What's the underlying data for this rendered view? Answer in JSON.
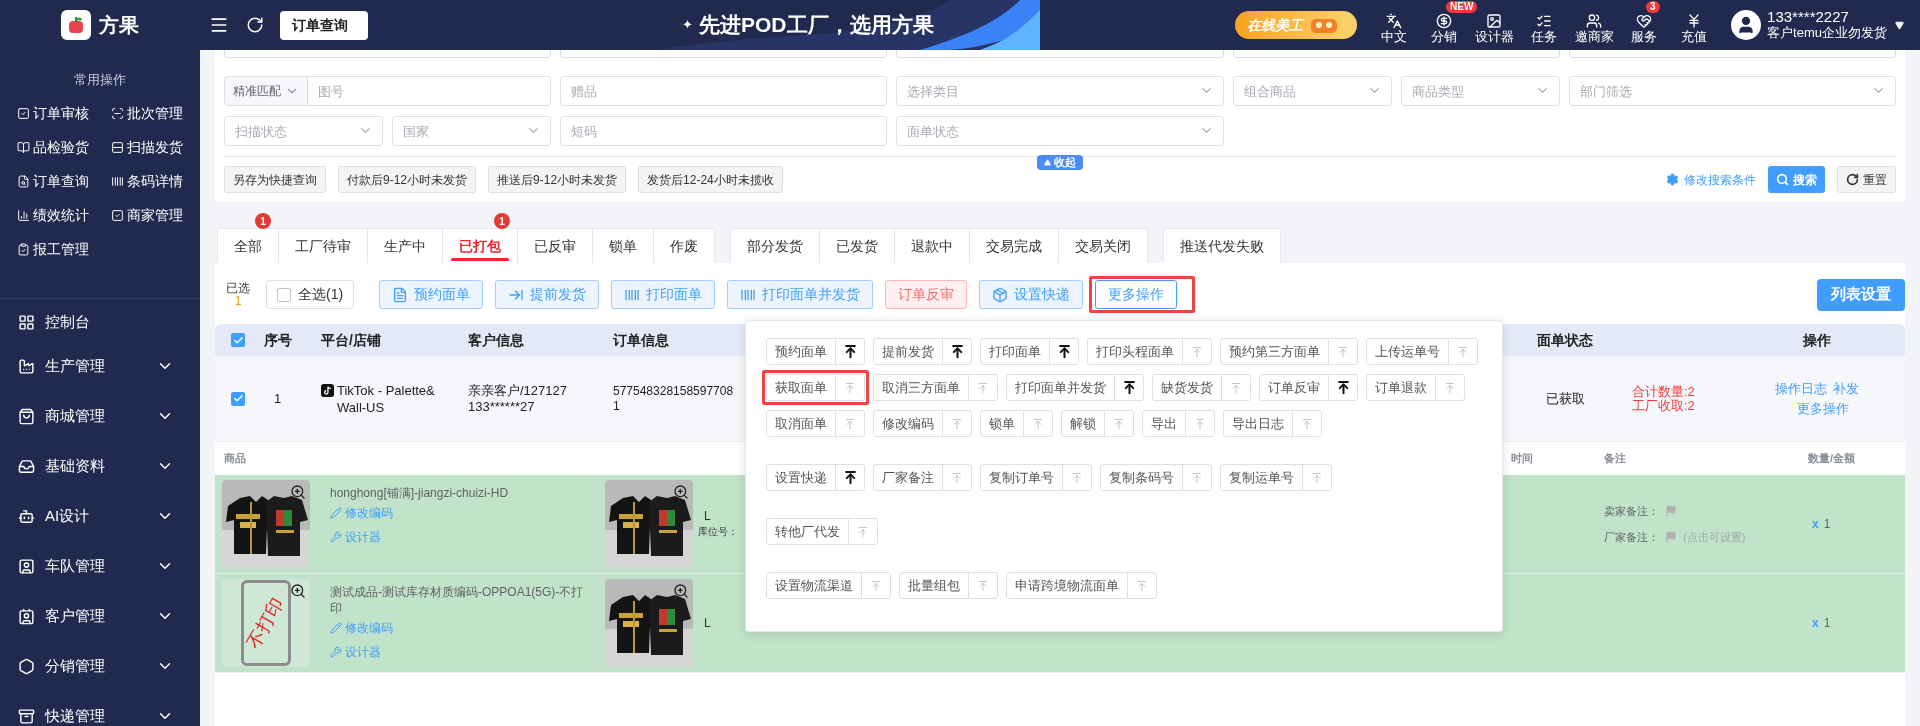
{
  "sidebar": {
    "logo": "方果",
    "quick_title": "常用操作",
    "quick_items": [
      "订单审核",
      "批次管理",
      "品检验货",
      "扫描发货",
      "订单查询",
      "条码详情",
      "绩效统计",
      "商家管理",
      "报工管理"
    ],
    "menu": [
      {
        "label": "控制台",
        "kind": "link"
      },
      {
        "label": "生产管理",
        "kind": "group"
      },
      {
        "label": "商城管理",
        "kind": "group"
      },
      {
        "label": "基础资料",
        "kind": "group"
      },
      {
        "label": "AI设计",
        "kind": "group"
      },
      {
        "label": "车队管理",
        "kind": "group"
      },
      {
        "label": "客户管理",
        "kind": "group"
      },
      {
        "label": "分销管理",
        "kind": "group"
      },
      {
        "label": "快递管理",
        "kind": "group"
      }
    ]
  },
  "topbar": {
    "page_tab": "订单查询",
    "slogan_mark": "✦",
    "slogan": "先进POD工厂，选用方果",
    "promo": "在线美工",
    "nav": [
      {
        "label": "中文"
      },
      {
        "label": "分销",
        "badge": "NEW"
      },
      {
        "label": "设计器"
      },
      {
        "label": "任务"
      },
      {
        "label": "邀商家"
      },
      {
        "label": "服务",
        "badge": "3"
      },
      {
        "label": "充值"
      }
    ],
    "user": {
      "phone": "133****2227",
      "name": "客户temu企业勿发货"
    }
  },
  "filters": {
    "rows": [
      [
        {
          "fields": [
            {
              "kind": "addon",
              "value": "精准匹配"
            },
            {
              "kind": "input",
              "placeholder": "图号"
            }
          ]
        },
        {
          "fields": [
            {
              "kind": "input",
              "placeholder": "赠品"
            }
          ]
        },
        {
          "fields": [
            {
              "kind": "select",
              "placeholder": "选择类目"
            }
          ]
        },
        {
          "fields": [
            {
              "kind": "select",
              "placeholder": "组合商品"
            },
            {
              "kind": "select",
              "placeholder": "商品类型"
            }
          ]
        },
        {
          "fields": [
            {
              "kind": "select",
              "placeholder": "部门筛选"
            }
          ]
        }
      ],
      [
        {
          "fields": [
            {
              "kind": "select",
              "placeholder": "扫描状态"
            },
            {
              "kind": "select",
              "placeholder": "国家"
            }
          ]
        },
        {
          "fields": [
            {
              "kind": "input",
              "placeholder": "短码"
            }
          ]
        },
        {
          "fields": [
            {
              "kind": "select",
              "placeholder": "面单状态"
            }
          ]
        }
      ]
    ],
    "collapse": "收起",
    "shortcuts": [
      "另存为快捷查询",
      "付款后9-12小时未发货",
      "推送后9-12小时未发货",
      "发货后12-24小时未揽收"
    ],
    "edit_conditions": "修改搜索条件",
    "search": "搜索",
    "reset": "重置"
  },
  "tabs": {
    "groups": [
      [
        {
          "label": "全部",
          "selected": false,
          "badge": "1"
        },
        {
          "label": "工厂待审",
          "selected": false
        },
        {
          "label": "生产中",
          "selected": false
        },
        {
          "label": "已打包",
          "selected": true,
          "badge": "1"
        },
        {
          "label": "已反审",
          "selected": false
        },
        {
          "label": "锁单",
          "selected": false
        },
        {
          "label": "作废",
          "selected": false
        }
      ],
      [
        {
          "label": "部分发货",
          "selected": false
        },
        {
          "label": "已发货",
          "selected": false
        },
        {
          "label": "退款中",
          "selected": false
        },
        {
          "label": "交易完成",
          "selected": false
        },
        {
          "label": "交易关闭",
          "selected": false
        }
      ],
      [
        {
          "label": "推送代发失败",
          "selected": false
        }
      ]
    ]
  },
  "toolbar": {
    "selected_label": "已选",
    "selected_count": "1",
    "select_all": {
      "label": "全选(1)",
      "checked": false
    },
    "actions": [
      {
        "label": "预约面单",
        "kind": "light",
        "highlighted": false
      },
      {
        "label": "提前发货",
        "kind": "light",
        "highlighted": false
      },
      {
        "label": "打印面单",
        "kind": "light",
        "highlighted": false
      },
      {
        "label": "打印面单并发货",
        "kind": "light",
        "highlighted": false
      },
      {
        "label": "订单反审",
        "kind": "danger",
        "highlighted": false
      },
      {
        "label": "设置快递",
        "kind": "light",
        "highlighted": false
      },
      {
        "label": "更多操作",
        "kind": "outline",
        "highlighted": true
      }
    ],
    "list_settings": "列表设置"
  },
  "table": {
    "all_checked": true,
    "columns": [
      "序号",
      "平台/店铺",
      "客户信息",
      "订单信息",
      "面单状态",
      "操作"
    ],
    "order": {
      "checked": true,
      "index": "1",
      "store": "TikTok - Palette&Wall-US",
      "customer": "亲亲客户/127127",
      "phone": "133******27",
      "order_no": "5775483281585977081",
      "label_status": "已获取",
      "totals": [
        "合计数量:2",
        "工厂收取:2"
      ],
      "actions": [
        "操作日志",
        "补发",
        "更多操作"
      ]
    },
    "product_columns": [
      "商品",
      "时间",
      "备注",
      "数量/金额"
    ],
    "products": [
      {
        "kind": "picture",
        "name": "honghong[铺满]-jiangzi-chuizi-HD",
        "edit": "修改编码",
        "designer": "设计器",
        "size": "L",
        "location": "库位号：",
        "seller_note": "卖家备注：",
        "factory_note": "厂家备注：",
        "factory_hint": "(点击可设置)",
        "qty_mark": "x",
        "qty": "1"
      },
      {
        "kind": "no-print",
        "stamp": "不打印",
        "name": "测试成品-测试库存材质编码-OPPOA1(5G)-不打印",
        "edit": "修改编码",
        "designer": "设计器",
        "size": "L",
        "qty_mark": "x",
        "qty": "1"
      }
    ]
  },
  "more_menu": {
    "groups": [
      {
        "items": [
          {
            "label": "预约面单",
            "pinned": true,
            "highlighted": false
          },
          {
            "label": "提前发货",
            "pinned": true,
            "highlighted": false
          },
          {
            "label": "打印面单",
            "pinned": true,
            "highlighted": false
          },
          {
            "label": "打印头程面单",
            "pinned": false,
            "highlighted": false
          },
          {
            "label": "预约第三方面单",
            "pinned": false,
            "highlighted": false
          },
          {
            "label": "上传运单号",
            "pinned": false,
            "highlighted": false
          },
          {
            "label": "获取面单",
            "pinned": false,
            "highlighted": true
          },
          {
            "label": "取消三方面单",
            "pinned": false,
            "highlighted": false
          },
          {
            "label": "打印面单并发货",
            "pinned": true,
            "highlighted": false
          },
          {
            "label": "缺货发货",
            "pinned": false,
            "highlighted": false
          },
          {
            "label": "订单反审",
            "pinned": true,
            "highlighted": false
          },
          {
            "label": "订单退款",
            "pinned": false,
            "highlighted": false
          },
          {
            "label": "取消面单",
            "pinned": false,
            "highlighted": false
          },
          {
            "label": "修改编码",
            "pinned": false,
            "highlighted": false
          },
          {
            "label": "锁单",
            "pinned": false,
            "highlighted": false
          },
          {
            "label": "解锁",
            "pinned": false,
            "highlighted": false
          },
          {
            "label": "导出",
            "pinned": false,
            "highlighted": false
          },
          {
            "label": "导出日志",
            "pinned": false,
            "highlighted": false
          }
        ]
      },
      {
        "items": [
          {
            "label": "设置快递",
            "pinned": true,
            "highlighted": false
          },
          {
            "label": "厂家备注",
            "pinned": false,
            "highlighted": false
          },
          {
            "label": "复制订单号",
            "pinned": false,
            "highlighted": false
          },
          {
            "label": "复制条码号",
            "pinned": false,
            "highlighted": false
          },
          {
            "label": "复制运单号",
            "pinned": false,
            "highlighted": false
          }
        ]
      },
      {
        "items": [
          {
            "label": "转他厂代发",
            "pinned": false,
            "highlighted": false
          }
        ]
      },
      {
        "items": [
          {
            "label": "设置物流渠道",
            "pinned": false,
            "highlighted": false
          },
          {
            "label": "批量组包",
            "pinned": false,
            "highlighted": false
          },
          {
            "label": "申请跨境物流面单",
            "pinned": false,
            "highlighted": false
          }
        ]
      }
    ]
  }
}
